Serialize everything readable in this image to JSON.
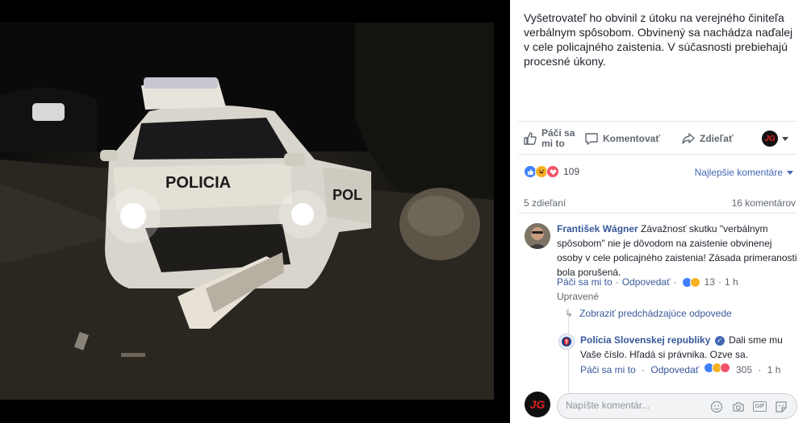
{
  "photo": {
    "car_text": "POLICIA",
    "door_text": "POL"
  },
  "post": {
    "caption": "Vyšetrovateľ ho obvinil z útoku na verejného činiteľa verbálnym spôsobom. Obvinený sa nachádza naďalej v cele policajného zaistenia. V súčasnosti prebiehajú procesné úkony."
  },
  "actions": {
    "like": "Páči sa mi to",
    "comment": "Komentovať",
    "share": "Zdieľať",
    "page_initials": "JG"
  },
  "reactions": {
    "count": "109",
    "sort_label": "Najlepšie komentáre",
    "shares": "5 zdieľaní",
    "comments": "16 komentárov"
  },
  "comment": {
    "author": "František Wágner",
    "text": "Závažnosť skutku \"verbálnym spôsobom\" nie je dôvodom na zaistenie obvinenej osoby v cele policajného zaistenia! Zásada primeranosti bola porušená.",
    "like_label": "Páči sa mi to",
    "reply_label": "Odpovedať",
    "reaction_count": "13",
    "time": "1 h",
    "edited": "Upravené"
  },
  "thread": {
    "show_previous": "Zobraziť predchádzajúce odpovede"
  },
  "reply": {
    "author": "Polícia Slovenskej republiky",
    "text": "Dali sme mu Vaše číslo. Hľadá si právnika. Ozve sa.",
    "like_label": "Páči sa mi to",
    "reply_label": "Odpovedať",
    "reaction_count": "305",
    "time": "1 h"
  },
  "composer": {
    "placeholder": "Napíšte komentár...",
    "avatar_initials": "JG"
  },
  "colors": {
    "link": "#385898",
    "accent": "#4267b2",
    "like": "#4080ff",
    "haha": "#f7b125",
    "love": "#f25268"
  }
}
